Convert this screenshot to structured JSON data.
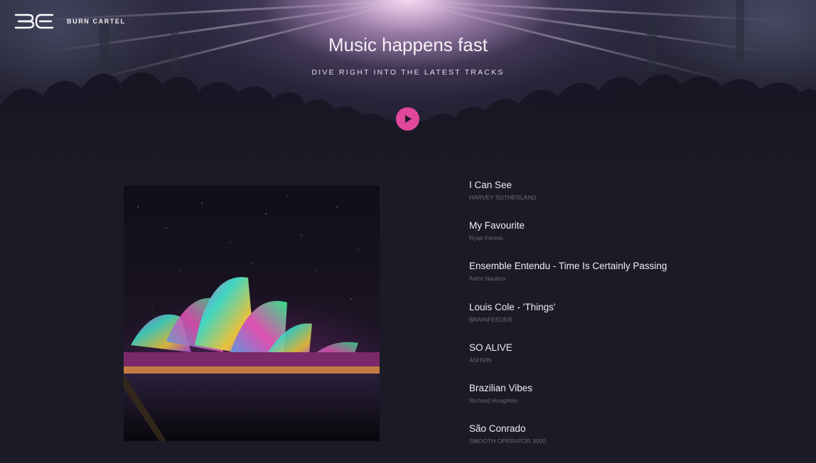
{
  "brand": {
    "name": "BURN CARTEL",
    "logo_text": "BC"
  },
  "hero": {
    "title": "Music happens fast",
    "subtitle": "DIVE RIGHT INTO THE LATEST TRACKS",
    "play_icon": "play-icon",
    "accent_color": "#e0489c"
  },
  "cover": {
    "description_icon": "album-art"
  },
  "tracks": [
    {
      "title": "I Can See",
      "artist": "HARVEY SUTHERLAND"
    },
    {
      "title": "My Favourite",
      "artist": "Ryan Fennis"
    },
    {
      "title": "Ensemble Entendu - Time Is Certainly Passing",
      "artist": "Astro Nautico"
    },
    {
      "title": "Louis Cole - 'Things'",
      "artist": "BRAINFEEDER"
    },
    {
      "title": "SO ALIVE",
      "artist": "ASHVIN"
    },
    {
      "title": "Brazilian Vibes",
      "artist": "Richard Houghten"
    },
    {
      "title": "São Conrado",
      "artist": "SMOOTH OPERATOR 3000"
    }
  ]
}
